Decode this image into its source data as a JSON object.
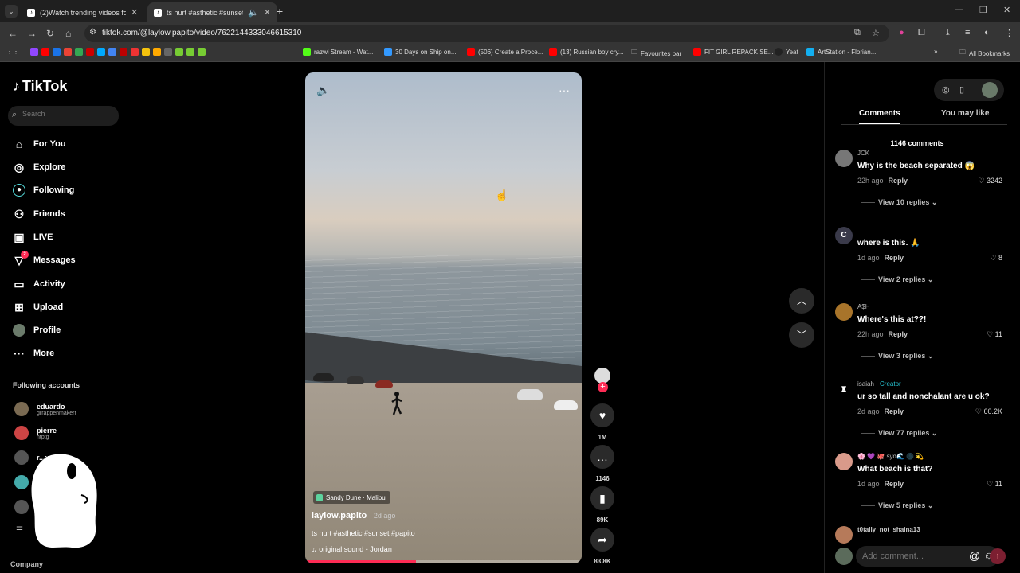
{
  "browser": {
    "tabs": [
      {
        "title": "(2)Watch trending videos for yo",
        "active": false
      },
      {
        "title": "ts hurt #asthetic #sunset #p",
        "active": true
      }
    ],
    "url": "tiktok.com/@laylow.papito/video/7622144333046615310",
    "bookmarks": [
      "razwi Stream - Wat...",
      "30 Days on Ship on...",
      "(506) Create a Proce...",
      "(13) Russian boy cry...",
      "Favourites bar",
      "FIT GIRL REPACK SE...",
      "Yeat",
      "ArtStation - Florian...",
      "All Bookmarks"
    ]
  },
  "sidebar": {
    "logo": "TikTok",
    "search_placeholder": "Search",
    "menu": [
      {
        "label": "For You",
        "icon": "home-icon"
      },
      {
        "label": "Explore",
        "icon": "compass-icon"
      },
      {
        "label": "Following",
        "icon": "following-icon"
      },
      {
        "label": "Friends",
        "icon": "friends-icon"
      },
      {
        "label": "LIVE",
        "icon": "live-icon"
      },
      {
        "label": "Messages",
        "icon": "messages-icon",
        "badge": "2"
      },
      {
        "label": "Activity",
        "icon": "activity-icon"
      },
      {
        "label": "Upload",
        "icon": "upload-icon"
      },
      {
        "label": "Profile",
        "icon": "profile-avatar"
      },
      {
        "label": "More",
        "icon": "more-icon"
      }
    ],
    "following_title": "Following accounts",
    "accounts": [
      {
        "name": "eduardo",
        "handle": "grrappenmakerr"
      },
      {
        "name": "pierre",
        "handle": "htptg"
      },
      {
        "name": "r...xxx",
        "handle": ""
      }
    ],
    "company": "Company"
  },
  "video": {
    "location": "Sandy Dune · Malibu",
    "author": "laylow.papito",
    "posted": "· 2d ago",
    "caption": "ts hurt #asthetic #sunset #papito",
    "sound": "original sound - Jordan",
    "progress": 0.4
  },
  "actions": {
    "likes": "1M",
    "comments": "1146",
    "saves": "89K",
    "shares": "83.8K"
  },
  "panel": {
    "tabs": [
      "Comments",
      "You may like"
    ],
    "comment_count": "1146 comments",
    "comments": [
      {
        "user": "JCK",
        "creator": "",
        "avatar": "",
        "text": "Why is the beach separated 😱",
        "ago": "22h ago",
        "likes": "3242",
        "replies": "View 10 replies"
      },
      {
        "user": "",
        "creator": "",
        "avatar": "C",
        "text": "where is this. 🙏",
        "ago": "1d ago",
        "likes": "8",
        "replies": "View 2 replies"
      },
      {
        "user": "A$H",
        "creator": "",
        "avatar": "",
        "text": "Where's this at??!",
        "ago": "22h ago",
        "likes": "11",
        "replies": "View 3 replies"
      },
      {
        "user": "isaiah",
        "creator": " · Creator",
        "avatar": "",
        "text": "ur so tall and nonchalant are u ok?",
        "ago": "2d ago",
        "likes": "60.2K",
        "replies": "View 77 replies"
      },
      {
        "user": "🌸 💜 🐙 syd🌊 🌑 💫",
        "creator": "",
        "avatar": "",
        "text": "What beach is that?",
        "ago": "1d ago",
        "likes": "11",
        "replies": "View 5 replies"
      },
      {
        "user": "t0tally_not_shaina13",
        "creator": "",
        "avatar": "",
        "text": "",
        "ago": "",
        "likes": "",
        "replies": ""
      }
    ],
    "reply_label": "Reply",
    "add_comment_placeholder": "Add comment..."
  },
  "colors": {
    "accent": "#fe2c55",
    "creator": "#26c4d3"
  }
}
